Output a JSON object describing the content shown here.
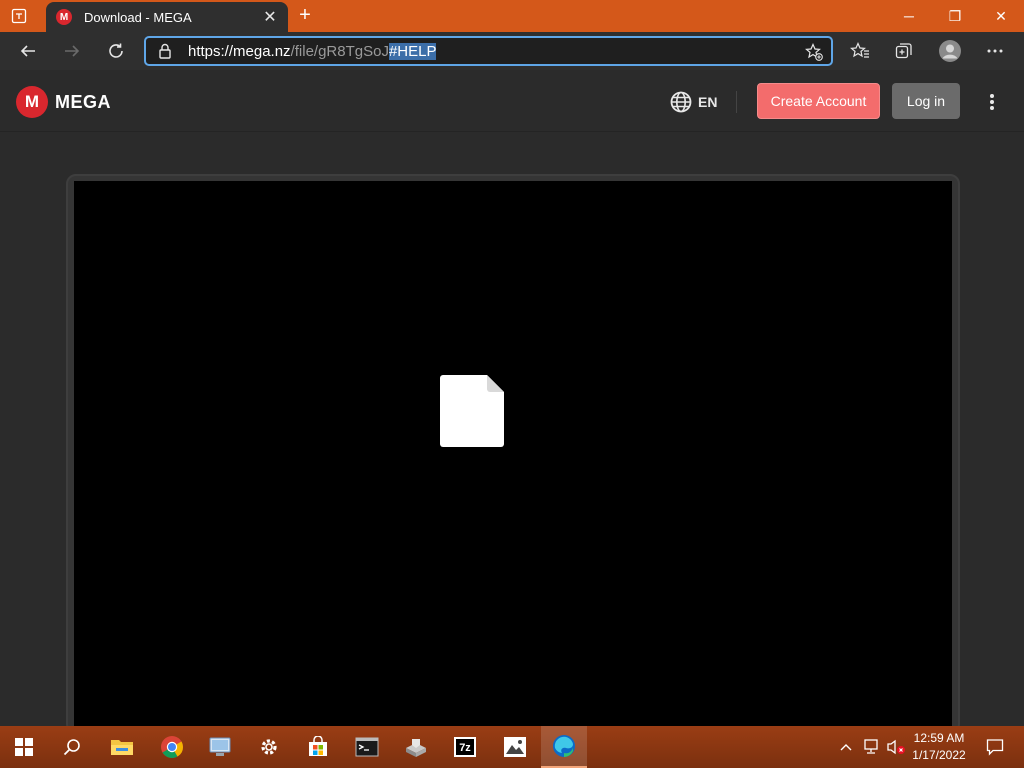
{
  "browser": {
    "tab": {
      "title": "Download - MEGA",
      "favicon_letter": "M",
      "close_glyph": "✕"
    },
    "new_tab_glyph": "+",
    "url": {
      "scheme_host": "https://mega.nz",
      "path": "/file/gR8TgSoJ",
      "selected": "#HELP"
    },
    "window_controls": {
      "minimize": "─",
      "restore": "❐",
      "close": "✕"
    }
  },
  "mega_header": {
    "logo_letter": "M",
    "wordmark": "MEGA",
    "language": "EN",
    "create_account_label": "Create Account",
    "login_label": "Log in"
  },
  "taskbar": {
    "time": "12:59 AM",
    "date": "1/17/2022",
    "pinned": [
      "start-icon",
      "search-icon",
      "file-explorer-icon",
      "chrome-icon",
      "remote-desktop-icon",
      "settings-icon",
      "store-icon",
      "terminal-icon",
      "app-installer-icon",
      "7zip-icon",
      "photos-icon",
      "edge-icon"
    ]
  },
  "colors": {
    "titlebar": "#d4581a",
    "mega_red": "#d9272e",
    "create_account": "#f36c6c",
    "login": "#6b6b6b",
    "url_focus": "#5fa6e8"
  }
}
